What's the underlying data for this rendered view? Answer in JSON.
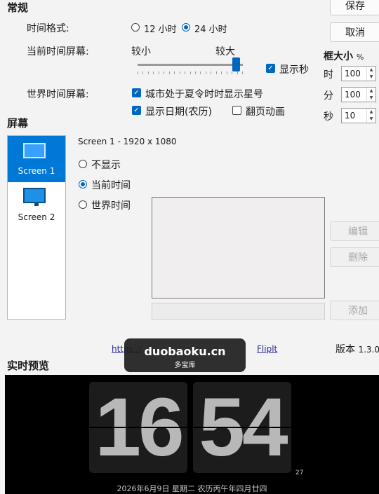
{
  "general": {
    "title": "常规",
    "time_format_label": "时间格式:",
    "opt_12": "12 小时",
    "opt_24": "24 小时",
    "current_screen_label": "当前时间屏幕:",
    "smaller": "较小",
    "larger": "较大",
    "show_seconds": "显示秒",
    "world_screen_label": "世界时间屏幕:",
    "dst_star": "城市处于夏令时时显示星号",
    "show_date": "显示日期(农历)",
    "flip_anim": "翻页动画",
    "size_slider_fraction": 0.97
  },
  "buttons": {
    "save": "保存",
    "cancel": "取消",
    "edit": "编辑",
    "delete": "删除",
    "add": "添加"
  },
  "frame": {
    "title": "框大小",
    "unit": "%",
    "hour_label": "时",
    "hour_value": "100",
    "min_label": "分",
    "min_value": "100",
    "sec_label": "秒",
    "sec_value": "10"
  },
  "screens": {
    "title": "屏幕",
    "items": [
      {
        "label": "Screen 1"
      },
      {
        "label": "Screen 2"
      }
    ],
    "selected_info": "Screen 1 - 1920 x 1080",
    "opt_none": "不显示",
    "opt_current": "当前时间",
    "opt_world": "世界时间"
  },
  "footer": {
    "link": "https://github.com/Fliplt",
    "link_prefix": "https://",
    "link_suffix": "Fliplt",
    "version_label": "版本",
    "version_value": "1.3.0"
  },
  "watermark": {
    "main": "duobaoku.cn",
    "sub": "多宝库"
  },
  "preview": {
    "title": "实时预览",
    "hour": "16",
    "minute": "54",
    "seconds": "27",
    "date_line": "2026年6月9日  星期二  农历丙午年四月廿四"
  },
  "colors": {
    "accent": "#0067c0",
    "preview_bg": "#000000",
    "flip_card": "#1c1c1c"
  }
}
